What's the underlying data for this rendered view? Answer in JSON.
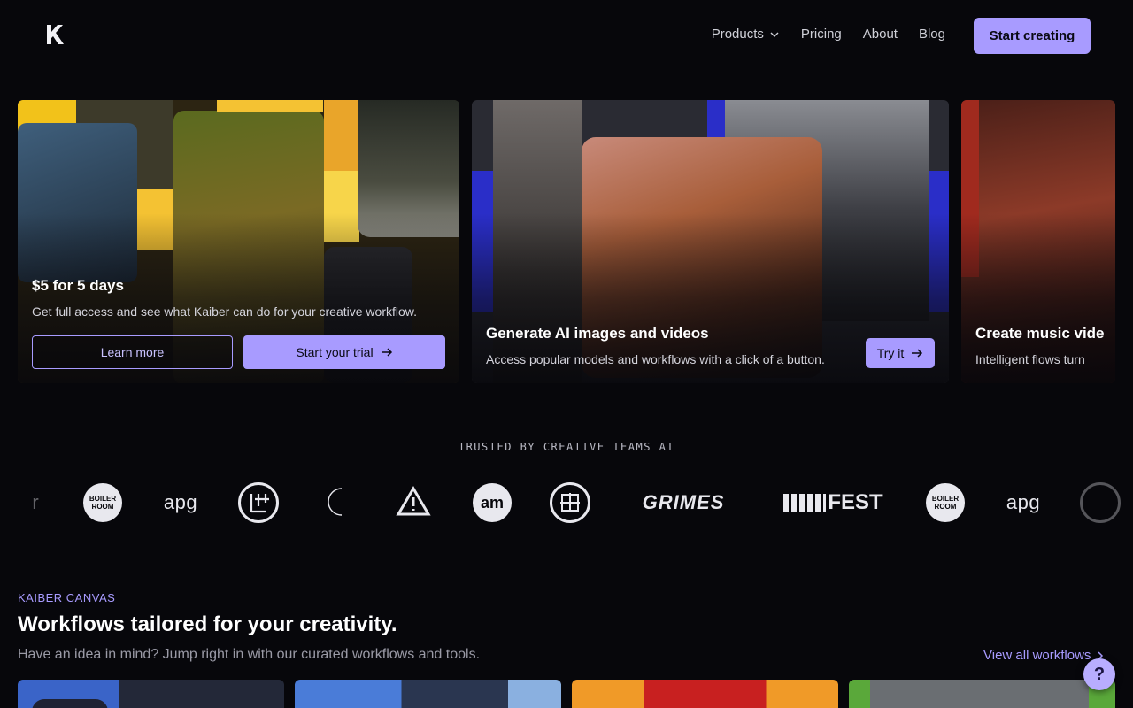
{
  "nav": {
    "logo": "kaiber-logo",
    "links": [
      {
        "label": "Products",
        "has_dropdown": true
      },
      {
        "label": "Pricing"
      },
      {
        "label": "About"
      },
      {
        "label": "Blog"
      }
    ],
    "cta_label": "Start creating"
  },
  "cards": {
    "trial": {
      "title": "$5 for 5 days",
      "description": "Get full access and see what Kaiber can do for your creative workflow.",
      "secondary_label": "Learn more",
      "primary_label": "Start your trial"
    },
    "generate": {
      "title": "Generate AI images and videos",
      "description": "Access popular models and workflows with a click of a button.",
      "button_label": "Try it"
    },
    "music": {
      "title": "Create music vide",
      "description": "Intelligent flows turn"
    }
  },
  "trusted": {
    "label": "TRUSTED BY CREATIVE TEAMS AT",
    "logos": {
      "boiler_room": "BOILER ROOM",
      "apg": "apg",
      "grimes": "GRIMES",
      "fest_suffix": "FEST"
    }
  },
  "section": {
    "eyebrow": "KAIBER CANVAS",
    "heading": "Workflows tailored for your creativity.",
    "subheading": "Have an idea in mind? Jump right in with our curated workflows and tools.",
    "view_all_label": "View all workflows",
    "help_label": "?"
  },
  "colors": {
    "accent": "#a89bff",
    "background": "#07070b"
  }
}
